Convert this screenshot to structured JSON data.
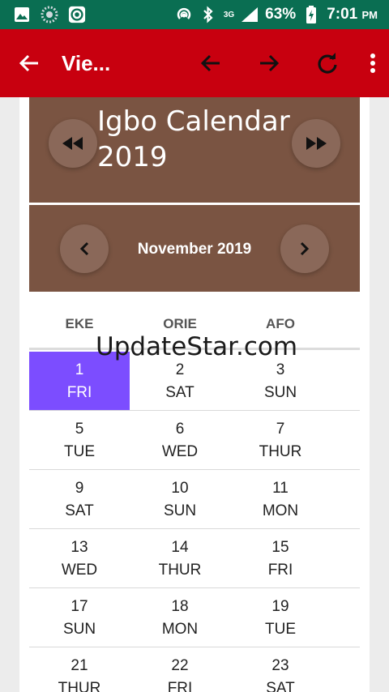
{
  "status_bar": {
    "battery": "63%",
    "time": "7:01",
    "time_suffix": "PM",
    "network": "3G",
    "icons": [
      "image-icon",
      "radar-icon",
      "record-icon",
      "hotspot-icon",
      "bluetooth-icon",
      "signal-icon",
      "battery-charging-icon"
    ]
  },
  "app_bar": {
    "title": "Vie...",
    "icons": [
      "back-arrow-icon",
      "arrow-left-icon",
      "arrow-right-icon",
      "refresh-icon",
      "more-vert-icon"
    ]
  },
  "year_panel": {
    "title": "Igbo Calendar 2019"
  },
  "month_panel": {
    "title": "November 2019"
  },
  "columns": [
    "EKE",
    "ORIE",
    "AFO"
  ],
  "watermark": "UpdateStar.com",
  "rows": [
    [
      {
        "day": "1",
        "dow": "FRI",
        "selected": true
      },
      {
        "day": "2",
        "dow": "SAT"
      },
      {
        "day": "3",
        "dow": "SUN"
      }
    ],
    [
      {
        "day": "5",
        "dow": "TUE"
      },
      {
        "day": "6",
        "dow": "WED"
      },
      {
        "day": "7",
        "dow": "THUR"
      }
    ],
    [
      {
        "day": "9",
        "dow": "SAT"
      },
      {
        "day": "10",
        "dow": "SUN"
      },
      {
        "day": "11",
        "dow": "MON"
      }
    ],
    [
      {
        "day": "13",
        "dow": "WED"
      },
      {
        "day": "14",
        "dow": "THUR"
      },
      {
        "day": "15",
        "dow": "FRI"
      }
    ],
    [
      {
        "day": "17",
        "dow": "SUN"
      },
      {
        "day": "18",
        "dow": "MON"
      },
      {
        "day": "19",
        "dow": "TUE"
      }
    ],
    [
      {
        "day": "21",
        "dow": "THUR"
      },
      {
        "day": "22",
        "dow": "FRI"
      },
      {
        "day": "23",
        "dow": "SAT"
      }
    ]
  ],
  "colors": {
    "app_bar": "#c8000f",
    "status_bar": "#0a6e52",
    "panel": "#7a5442",
    "selected": "#7c4dff"
  }
}
